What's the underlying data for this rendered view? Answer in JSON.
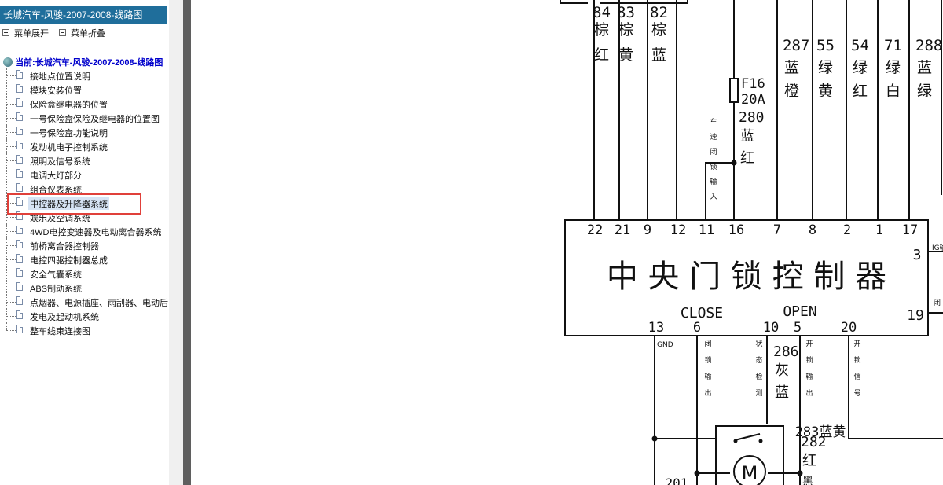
{
  "window": {
    "title": "长城汽车-风骏-2007-2008-线路图"
  },
  "menu_controls": {
    "expand": "菜单展开",
    "collapse": "菜单折叠"
  },
  "tree": {
    "root_label": "当前:长城汽车-风骏-2007-2008-线路图",
    "items": [
      "接地点位置说明",
      "模块安装位置",
      "保险盒继电器的位置",
      "一号保险盒保险及继电器的位置图",
      "一号保险盒功能说明",
      "发动机电子控制系统",
      "照明及信号系统",
      "电调大灯部分",
      "组合仪表系统",
      "中控器及升降器系统",
      "娱乐及空调系统",
      "4WD电控变速器及电动离合器系统",
      "前桥离合器控制器",
      "电控四驱控制器总成",
      "安全气囊系统",
      "ABS制动系统",
      "点烟器、电源插座、雨刮器、电动后",
      "发电及起动机系统",
      "整车线束连接图"
    ],
    "selected_index": 9
  },
  "diagram": {
    "top_wires": [
      {
        "num": "84",
        "c1": "棕",
        "c2": "红"
      },
      {
        "num": "83",
        "c1": "棕",
        "c2": "黄"
      },
      {
        "num": "82",
        "c1": "棕",
        "c2": "蓝"
      },
      {
        "num": "287",
        "c1": "蓝",
        "c2": "橙"
      },
      {
        "num": "55",
        "c1": "绿",
        "c2": "黄"
      },
      {
        "num": "54",
        "c1": "绿",
        "c2": "红"
      },
      {
        "num": "71",
        "c1": "绿",
        "c2": "白"
      },
      {
        "num": "288",
        "c1": "蓝",
        "c2": "绿"
      }
    ],
    "fuse_name": "F16",
    "fuse_rating": "20A",
    "wire_280": {
      "num": "280",
      "c1": "蓝",
      "c2": "红"
    },
    "vehicle_speed_label": [
      "车",
      "速",
      "闭",
      "锁",
      "输",
      "入"
    ],
    "top_pins": [
      "22",
      "21",
      "9",
      "12",
      "11",
      "16",
      "7",
      "8",
      "2",
      "1",
      "17"
    ],
    "controller_title": "中 央 门 锁 控 制 器",
    "close_label": "CLOSE",
    "open_label": "OPEN",
    "right_pin_3": "3",
    "right_pin_19": "19",
    "right_clip_top": "IG输",
    "right_clip_bottom": "闭",
    "bottom_pins": [
      "13",
      "6",
      "10",
      "5",
      "20"
    ],
    "gnd_label": "GND",
    "lock_out_label": [
      "闭",
      "锁",
      "输",
      "出"
    ],
    "status_label": [
      "状",
      "态",
      "检",
      "测"
    ],
    "wire_286": {
      "num": "286",
      "c1": "灰",
      "c2": "蓝"
    },
    "unlock_out_label": [
      "开",
      "锁",
      "输",
      "出"
    ],
    "unlock_sig_label": [
      "开",
      "锁",
      "信",
      "号"
    ],
    "wire_283": "283蓝黄",
    "wire_282": {
      "num": "282",
      "c1": "红"
    },
    "motor_label": "M",
    "clip_201": "201",
    "clip_black": "黑"
  }
}
